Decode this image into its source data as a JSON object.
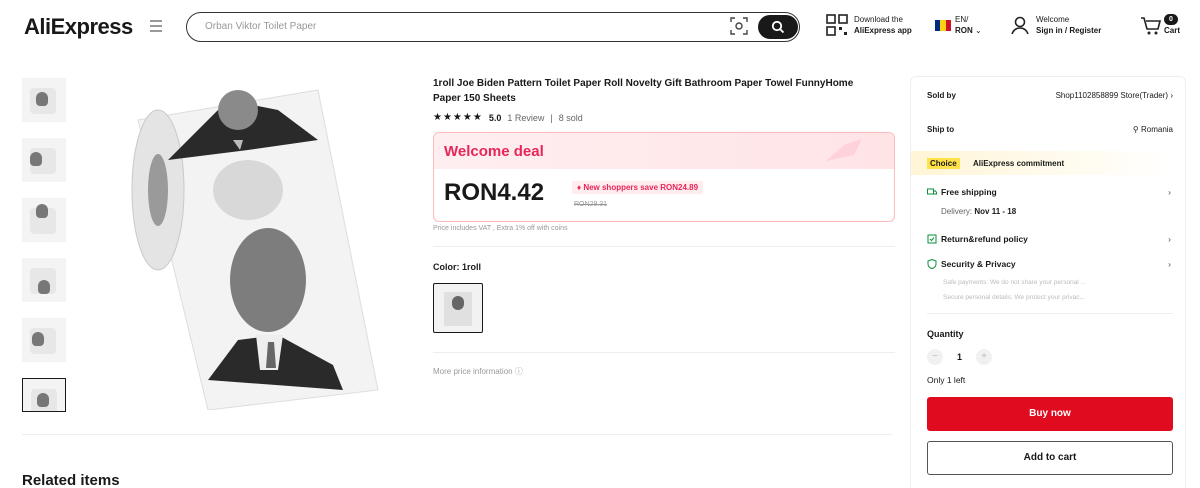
{
  "header": {
    "logo": "AliExpress",
    "search_placeholder": "Orban Viktor Toilet Paper",
    "download_line1": "Download the",
    "download_line2": "AliExpress app",
    "lang_line1": "EN/",
    "lang_line2": "RON",
    "welcome_line1": "Welcome",
    "welcome_line2": "Sign in / Register",
    "cart_count": "0",
    "cart_label": "Cart",
    "flag_colors": [
      "#002b7f",
      "#fcd116",
      "#ce1126"
    ]
  },
  "product": {
    "title": "1roll Joe Biden Pattern Toilet Paper Roll Novelty Gift Bathroom Paper Towel FunnyHome Paper 150 Sheets",
    "stars": "★★★★★",
    "rating": "5.0",
    "reviews": "1 Review",
    "sold": "8 sold",
    "deal_title": "Welcome deal",
    "price": "RON4.42",
    "save_text": "New shoppers save RON24.89",
    "old_price": "RON29.31",
    "vat_note": "Price includes VAT , Extra 1% off with coins",
    "color_label": "Color: 1roll",
    "more_price": "More price information"
  },
  "panel": {
    "sold_by_label": "Sold by",
    "sold_by_value": "Shop1102858899 Store(Trader)",
    "ship_to_label": "Ship to",
    "ship_to_value": "Romania",
    "choice_tag": "Choice",
    "choice_text": "AliExpress commitment",
    "free_shipping": "Free shipping",
    "delivery_label": "Delivery:",
    "delivery_dates": "Nov 11 - 18",
    "return_policy": "Return&refund policy",
    "security": "Security & Privacy",
    "security_note1": "Safe payments: We do not share your personal ...",
    "security_note2": "Secure personal details: We protect your privac...",
    "quantity_label": "Quantity",
    "quantity_value": "1",
    "qty_minus": "−",
    "qty_plus": "+",
    "only_left": "Only 1 left",
    "buy_now": "Buy now",
    "add_to_cart": "Add to cart"
  },
  "related_title": "Related items",
  "colors": {
    "accent_red": "#e10b1f",
    "deal_pink": "#e8265a",
    "choice_yellow": "#ffe24a"
  }
}
